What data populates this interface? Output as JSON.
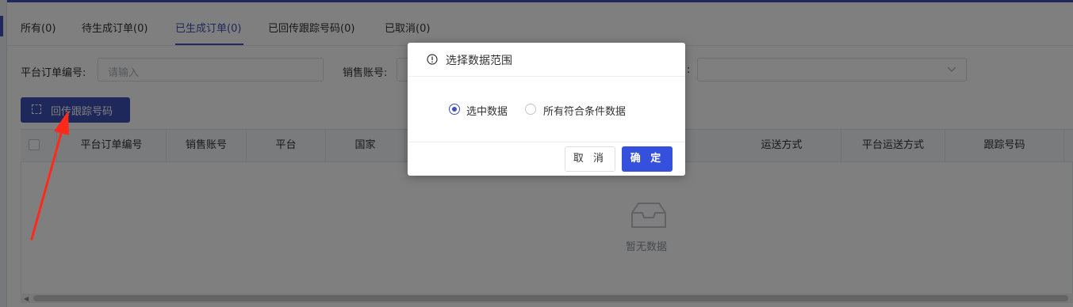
{
  "tabs": [
    {
      "label": "所有(0)"
    },
    {
      "label": "待生成订单(0)"
    },
    {
      "label": "已生成订单(0)"
    },
    {
      "label": "已回传跟踪号码(0)"
    },
    {
      "label": "已取消(0)"
    }
  ],
  "active_tab": "已生成订单(0)",
  "filters": {
    "platform_order_no_label": "平台订单编号:",
    "platform_order_no_placeholder": "请输入",
    "sales_account_label": "销售账号:",
    "hidden_label_suffix": ":"
  },
  "toolbar": {
    "return_tracking_button": "回传跟踪号码"
  },
  "table": {
    "columns_left": [
      "平台订单编号",
      "销售账号",
      "平台",
      "国家"
    ],
    "columns_right": [
      "运送方式",
      "平台运送方式",
      "跟踪号码"
    ],
    "empty_text": "暂无数据"
  },
  "dialog": {
    "title": "选择数据范围",
    "options": [
      {
        "label": "选中数据",
        "checked": true
      },
      {
        "label": "所有符合条件数据",
        "checked": false
      }
    ],
    "cancel_label": "取 消",
    "ok_label": "确 定"
  },
  "colors": {
    "primary": "#3f51b5",
    "ok_button": "#3550dd",
    "annotation_arrow": "#ff2a1a"
  }
}
